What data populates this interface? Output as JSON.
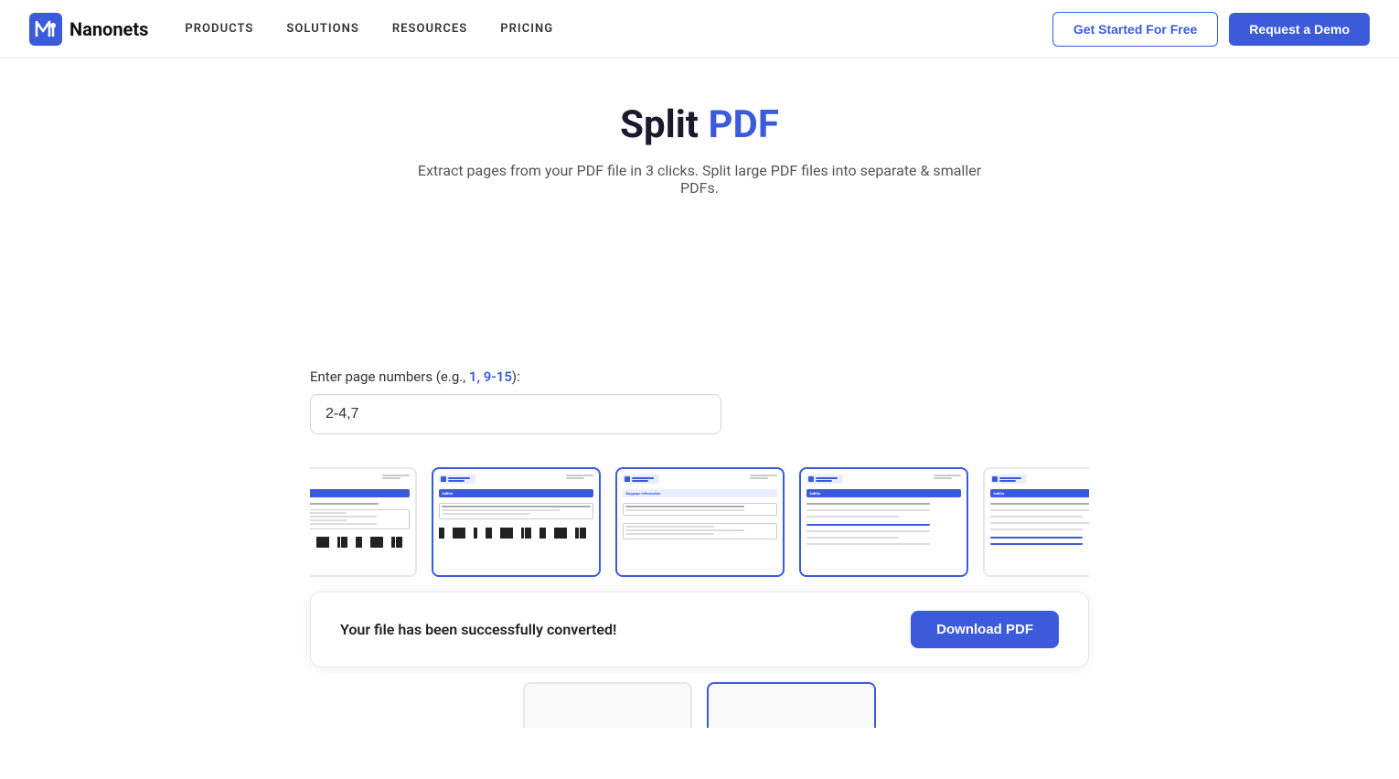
{
  "navbar": {
    "logo_text": "Nanonets",
    "links": [
      {
        "label": "PRODUCTS",
        "id": "products"
      },
      {
        "label": "SOLUTIONS",
        "id": "solutions"
      },
      {
        "label": "RESOURCES",
        "id": "resources"
      },
      {
        "label": "PRICING",
        "id": "pricing"
      }
    ],
    "cta_outline": "Get Started For Free",
    "cta_solid": "Request a Demo"
  },
  "hero": {
    "title_plain": "Split ",
    "title_blue": "PDF",
    "subtitle": "Extract pages from your PDF file in 3 clicks. Split large PDF files into separate & smaller PDFs."
  },
  "page_input": {
    "label_plain": "Enter page numbers (e.g., ",
    "label_highlight": "1, 9-15",
    "label_suffix": "):",
    "value": "2-4,7",
    "placeholder": ""
  },
  "thumbnails": [
    {
      "id": 1,
      "selected": false
    },
    {
      "id": 2,
      "selected": true
    },
    {
      "id": 3,
      "selected": true
    },
    {
      "id": 4,
      "selected": true
    },
    {
      "id": 5,
      "selected": false
    }
  ],
  "success_banner": {
    "message": "Your file has been successfully converted!",
    "download_label": "Download PDF"
  },
  "bottom_thumbnails": [
    {
      "id": 1,
      "selected": false
    },
    {
      "id": 2,
      "selected": true
    }
  ]
}
